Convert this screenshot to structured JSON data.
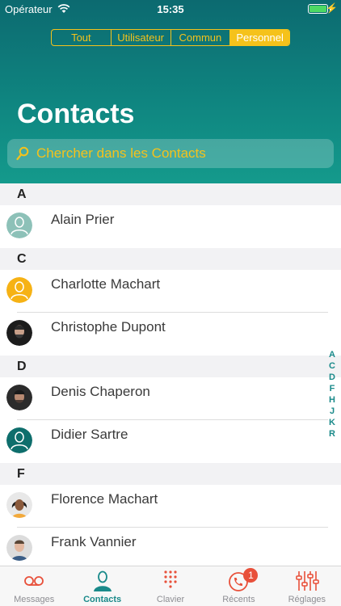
{
  "status_bar": {
    "carrier": "Opérateur",
    "time": "15:35"
  },
  "segmented_control": {
    "segments": [
      "Tout",
      "Utilisateur",
      "Commun",
      "Personnel"
    ],
    "selected": "Personnel"
  },
  "page": {
    "title": "Contacts"
  },
  "search": {
    "placeholder": "Chercher dans les Contacts"
  },
  "sections": [
    {
      "letter": "A",
      "contacts": [
        "Alain Prier"
      ]
    },
    {
      "letter": "C",
      "contacts": [
        "Charlotte Machart",
        "Christophe Dupont"
      ]
    },
    {
      "letter": "D",
      "contacts": [
        "Denis Chaperon",
        "Didier Sartre"
      ]
    },
    {
      "letter": "F",
      "contacts": [
        "Florence Machart",
        "Frank Vannier"
      ]
    }
  ],
  "index": [
    "A",
    "C",
    "D",
    "F",
    "H",
    "J",
    "K",
    "R"
  ],
  "tabbar": {
    "tabs": [
      {
        "label": "Messages",
        "icon": "voicemail-icon"
      },
      {
        "label": "Contacts",
        "icon": "person-icon"
      },
      {
        "label": "Clavier",
        "icon": "keypad-icon"
      },
      {
        "label": "Récents",
        "icon": "recent-calls-icon",
        "badge": "1"
      },
      {
        "label": "Réglages",
        "icon": "sliders-icon"
      }
    ],
    "active": "Contacts"
  },
  "colors": {
    "accent": "#f5c21b",
    "brand": "#1a8a8a",
    "tab_icon": "#e8503a",
    "badge": "#e8503a"
  }
}
